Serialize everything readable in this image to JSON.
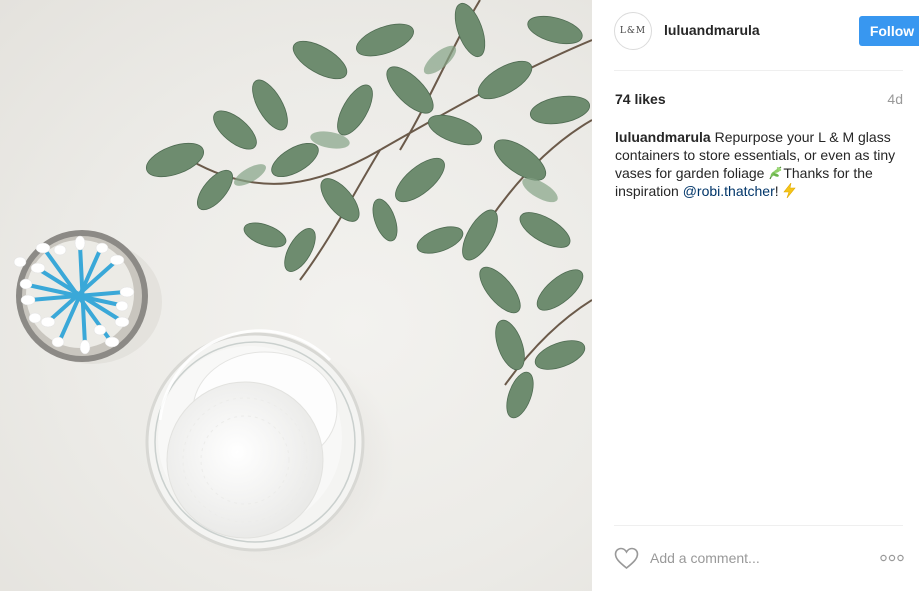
{
  "post": {
    "avatar_text": "L&M",
    "username": "luluandmarula",
    "follow_label": "Follow",
    "likes": "74 likes",
    "age": "4d",
    "caption": {
      "username": "luluandmarula",
      "text_1": " Repurpose your L & M glass containers to store essentials, or even as tiny vases for garden foliage ",
      "text_2": "Thanks for the inspiration ",
      "mention": "@robi.thatcher",
      "text_3": "! "
    },
    "comment_placeholder": "Add a comment...",
    "colors": {
      "follow": "#3897f0",
      "mention": "#003569",
      "muted": "#999999"
    },
    "icons": [
      "heart-icon",
      "more-options-icon",
      "herb-emoji-icon",
      "lightning-emoji-icon"
    ]
  }
}
